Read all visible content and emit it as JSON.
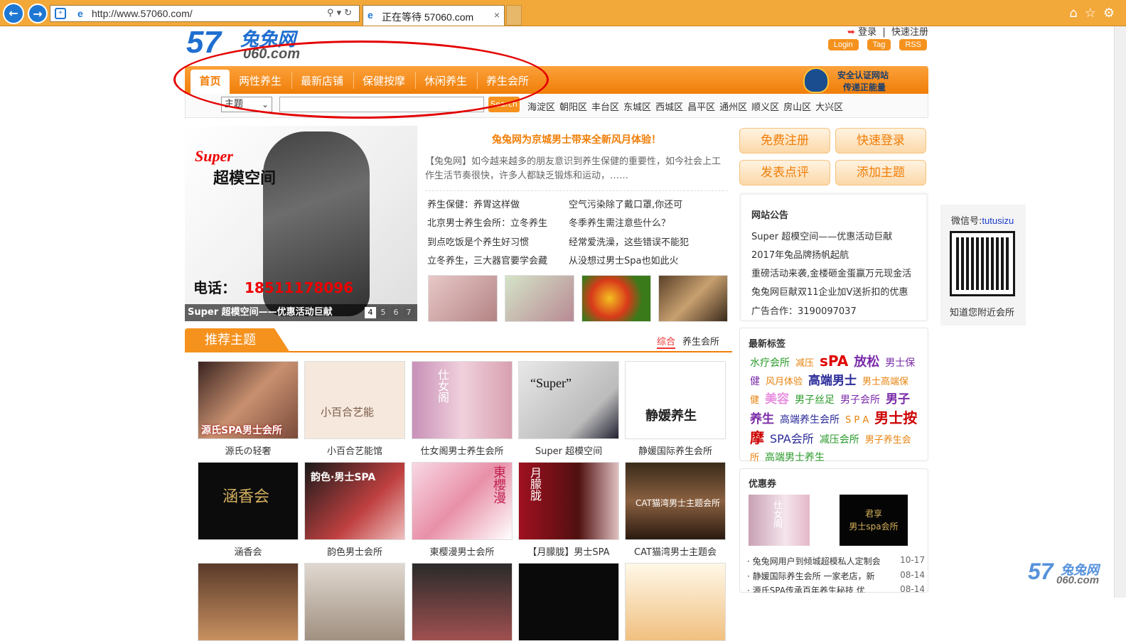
{
  "browser": {
    "url": "http://www.57060.com/",
    "tab_title": "正在等待 57060.com"
  },
  "site": {
    "logo_num": "57",
    "logo_cn": "兔兔网",
    "logo_sub": "060.com",
    "login_link": "登录",
    "register_link": "快速注册",
    "top_buttons": [
      "Login",
      "Tag",
      "RSS"
    ]
  },
  "nav": {
    "items": [
      "首页",
      "两性养生",
      "最新店铺",
      "保健按摩",
      "休闲养生",
      "养生会所"
    ],
    "secure_line1": "安全认证网站",
    "secure_line2": "传递正能量"
  },
  "search": {
    "select_value": "主题",
    "button": "Search",
    "districts": [
      "海淀区",
      "朝阳区",
      "丰台区",
      "东城区",
      "西城区",
      "昌平区",
      "通州区",
      "顺义区",
      "房山区",
      "大兴区"
    ]
  },
  "banner": {
    "super": "Super",
    "title": "超模空间",
    "phone_label": "电话：",
    "phone": "18511178096",
    "caption": "Super 超模空间——优惠活动巨献",
    "pages": [
      "4",
      "5",
      "6",
      "7"
    ]
  },
  "news": {
    "headline": "兔兔网为京城男士带来全新风月体验！",
    "summary": "【兔兔网】如今越来越多的朋友意识到养生保健的重要性，如今社会上工作生活节奏很快，许多人都缺乏锻炼和运动，……",
    "left": [
      "养生保健：养胃这样做",
      "北京男士养生会所：立冬养生",
      "到点吃饭是个养生好习惯",
      "立冬养生，三大器官要学会藏"
    ],
    "right": [
      "空气污染除了戴口罩,你还可",
      "冬季养生需注意些什么？",
      "经常爱洗澡，这些错误不能犯",
      "从没想过男士Spa也如此火"
    ]
  },
  "actions": [
    "免费注册",
    "快速登录",
    "发表点评",
    "添加主题"
  ],
  "notice": {
    "title": "网站公告",
    "items": [
      "Super 超模空间——优惠活动巨献",
      "2017年兔品牌扬帆起航",
      "重磅活动来袭,金楼砸金蛋赢万元现金活",
      "兔兔网巨献双11企业加V送折扣的优惠",
      "广告合作：3190097037"
    ]
  },
  "wechat": {
    "label": "微信号:",
    "id": "tutusizu",
    "caption": "知道您附近会所"
  },
  "recommend": {
    "title": "推荐主题",
    "tab_all": "综合",
    "tab_club": "养生会所",
    "row1": [
      "源氏の轻奢",
      "小百合艺能馆",
      "仕女阁男士养生会所",
      "Super 超模空间",
      "静媛国际养生会所"
    ],
    "row2": [
      "涵香会",
      "韵色男士会所",
      "東樱漫男士会所",
      "【月朦胧】男士SPA",
      "CAT猫湾男士主题会"
    ],
    "img_text1": [
      "源氏SPA男士会所",
      "小百合艺能",
      "仕女阁",
      "“Super”",
      "静媛养生"
    ],
    "img_text2": [
      "涵香会",
      "韵色·男士SPA",
      "東櫻漫",
      "月朦胧",
      "CAT猫湾男士主题会所"
    ]
  },
  "tags": {
    "title": "最新标签",
    "list": [
      {
        "t": "水疗会所",
        "c": "#2a9a2a",
        "s": 14
      },
      {
        "t": "减压",
        "c": "#e8830f",
        "s": 13
      },
      {
        "t": "sPA",
        "c": "#e00000",
        "s": 20
      },
      {
        "t": "放松",
        "c": "#7a2aa8",
        "s": 18
      },
      {
        "t": "男士保健",
        "c": "#7a2aa8",
        "s": 14
      },
      {
        "t": "风月体验",
        "c": "#e8830f",
        "s": 13
      },
      {
        "t": "高端男士",
        "c": "#2a2a9a",
        "s": 17
      },
      {
        "t": "男士高端保健",
        "c": "#e8830f",
        "s": 13
      },
      {
        "t": "美容",
        "c": "#e890e0",
        "s": 17
      },
      {
        "t": "男子丝足",
        "c": "#2a9a2a",
        "s": 14
      },
      {
        "t": "男子会所",
        "c": "#7a2aa8",
        "s": 14
      },
      {
        "t": "男子养生",
        "c": "#7a2aa8",
        "s": 17
      },
      {
        "t": "高端养生会所",
        "c": "#2a2a9a",
        "s": 14
      },
      {
        "t": "S P A",
        "c": "#e8830f",
        "s": 13
      },
      {
        "t": "男士按摩",
        "c": "#cc0000",
        "s": 20
      },
      {
        "t": "SPA会所",
        "c": "#2a2a9a",
        "s": 16
      },
      {
        "t": "减压会所",
        "c": "#2a9a2a",
        "s": 14
      },
      {
        "t": "男子养生会所",
        "c": "#e8830f",
        "s": 13
      },
      {
        "t": "高端男士养生",
        "c": "#2a9a2a",
        "s": 14
      }
    ]
  },
  "coupons": {
    "title": "优惠券",
    "img1": "仕女阁",
    "img2_l1": "君享",
    "img2_l2": "男士spa会所",
    "items": [
      {
        "t": "兔兔网用户到倾城超模私人定制会",
        "d": "10-17"
      },
      {
        "t": "静媛国际养生会所 一家老店，新",
        "d": "08-14"
      },
      {
        "t": "源氏SPA传承百年养生秘技 优",
        "d": "08-14"
      }
    ]
  },
  "watermark": {
    "num": "57",
    "cn": "兔兔网",
    "sub": "060.com"
  }
}
